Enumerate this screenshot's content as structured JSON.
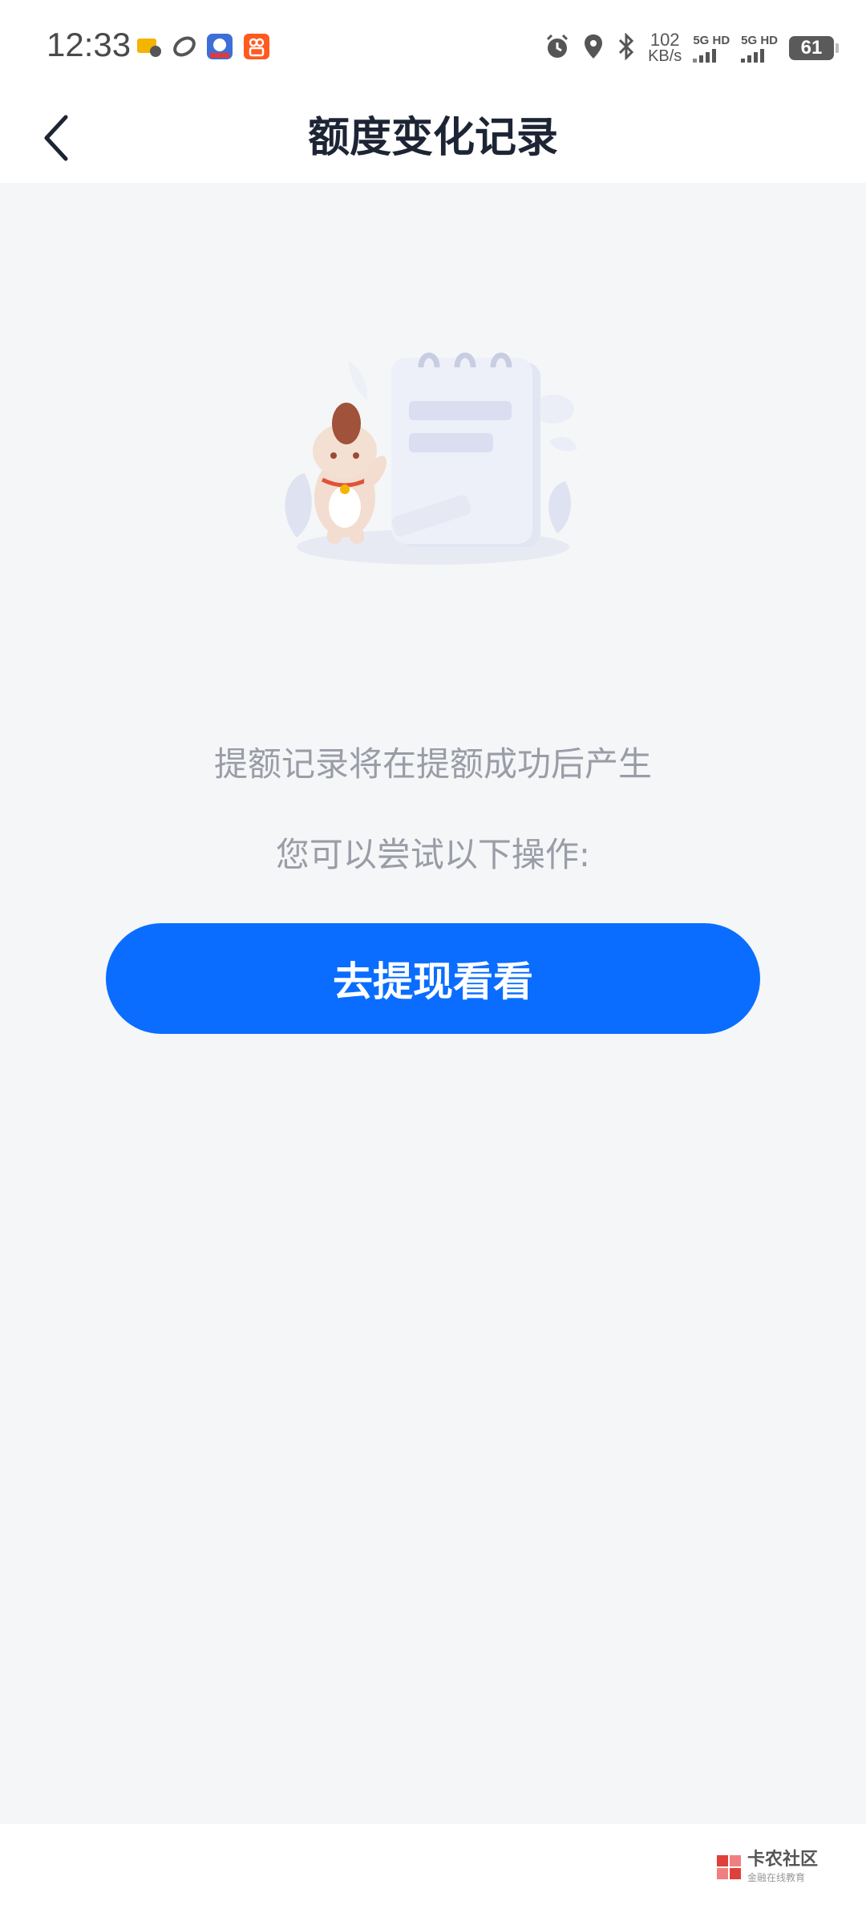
{
  "status_bar": {
    "time": "12:33",
    "net_speed_value": "102",
    "net_speed_unit": "KB/s",
    "sim1_label": "5G HD",
    "sim2_label": "5G HD",
    "battery_level": "61",
    "icons": [
      "weather-app-icon",
      "sync-app-icon",
      "news-app-icon",
      "video-app-icon",
      "alarm-icon",
      "location-icon",
      "bluetooth-icon"
    ]
  },
  "header": {
    "title": "额度变化记录",
    "back_icon": "chevron-left-icon"
  },
  "empty_state": {
    "illustration": "mascot-notebook-illustration",
    "message": "提额记录将在提额成功后产生",
    "hint": "您可以尝试以下操作:",
    "cta_label": "去提现看看"
  },
  "watermark": {
    "title": "卡农社区",
    "subtitle": "金融在线教育"
  },
  "colors": {
    "accent": "#0a6dff",
    "background": "#f4f6f8",
    "title": "#1d2535",
    "muted_text": "#9a9ca6"
  }
}
